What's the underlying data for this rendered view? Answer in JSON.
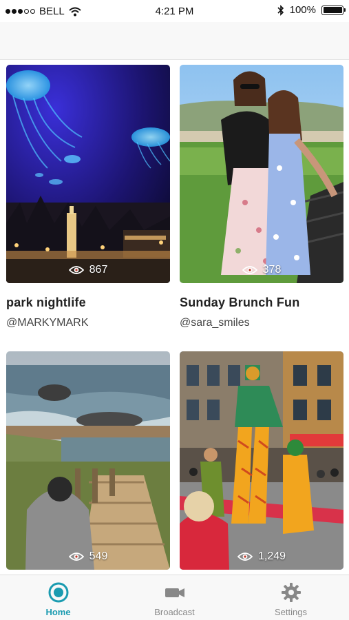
{
  "status_bar": {
    "carrier": "BELL",
    "time": "4:21 PM",
    "battery": "100%"
  },
  "feed": [
    {
      "title": "park nightlife",
      "user": "@MARKYMARK",
      "views": "867",
      "image": "jellyfish-night-plaza"
    },
    {
      "title": "Sunday Brunch Fun",
      "user": "@sara_smiles",
      "views": "378",
      "image": "two-friends-selfie"
    },
    {
      "title": "",
      "user": "",
      "views": "549",
      "image": "coastal-trail"
    },
    {
      "title": "",
      "user": "",
      "views": "1,249",
      "image": "street-parade"
    }
  ],
  "tabs": [
    {
      "label": "Home",
      "icon": "home-icon",
      "active": true
    },
    {
      "label": "Broadcast",
      "icon": "video-camera-icon",
      "active": false
    },
    {
      "label": "Settings",
      "icon": "gear-icon",
      "active": false
    }
  ],
  "colors": {
    "accent": "#1a9bb0",
    "inactive": "#888888"
  }
}
